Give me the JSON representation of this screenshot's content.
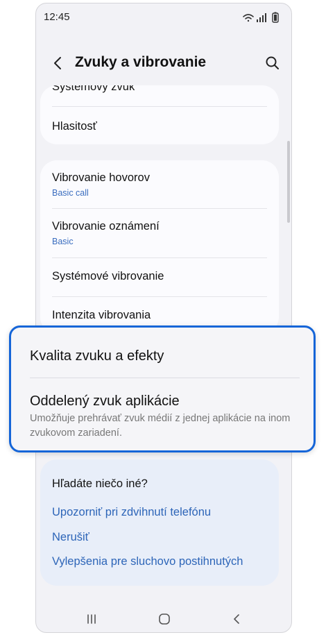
{
  "status_bar": {
    "time": "12:45"
  },
  "app_bar": {
    "title": "Zvuky a vibrovanie"
  },
  "group1": {
    "partial_item": "Systémový zvuk",
    "items": [
      {
        "label": "Hlasitosť"
      }
    ]
  },
  "group2": {
    "items": [
      {
        "label": "Vibrovanie hovorov",
        "sub": "Basic call"
      },
      {
        "label": "Vibrovanie oznámení",
        "sub": "Basic"
      },
      {
        "label": "Systémové vibrovanie"
      },
      {
        "label": "Intenzita vibrovania"
      }
    ]
  },
  "highlight": {
    "item1": "Kvalita zvuku a efekty",
    "item2": "Oddelený zvuk aplikácie",
    "item2_desc": "Umožňuje prehrávať zvuk médií z jednej aplikácie na inom zvukovom zariadení."
  },
  "suggestions": {
    "title": "Hľadáte niečo iné?",
    "links": [
      "Upozorniť pri zdvihnutí telefónu",
      "Nerušiť",
      "Vylepšenia pre sluchovo postihnutých"
    ]
  },
  "colors": {
    "accent": "#1565d8",
    "link": "#2d65b8",
    "sub": "#3a6dbf"
  }
}
